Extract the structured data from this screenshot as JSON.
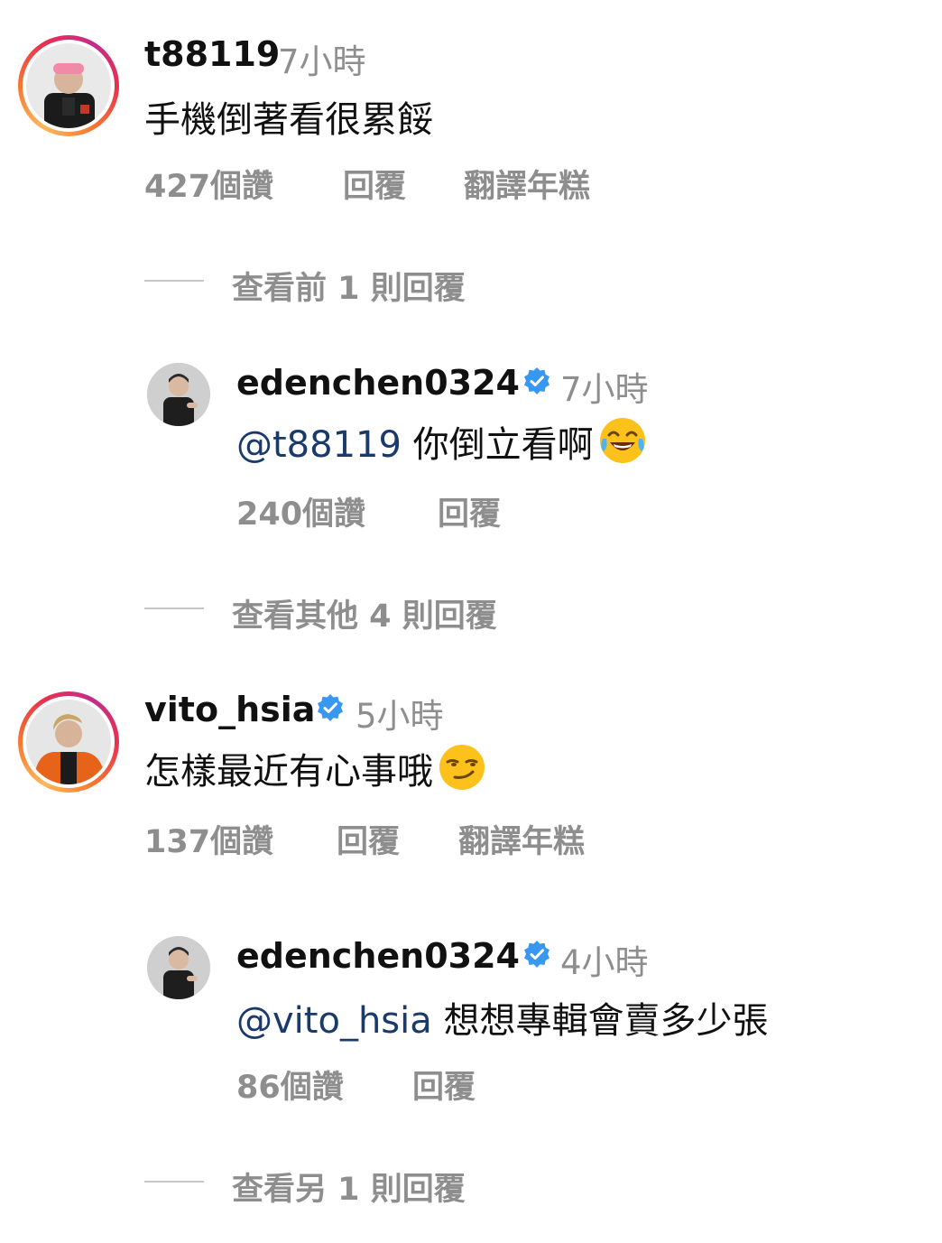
{
  "comments": [
    {
      "username": "t88119",
      "time": "7小時",
      "text": "手機倒著看很累餒",
      "likes": "427個讚",
      "reply_label": "回覆",
      "translate_label": "翻譯年糕",
      "view_replies": "查看前 1 則回覆",
      "replies": [
        {
          "username": "edenchen0324",
          "verified": true,
          "time": "7小時",
          "mention": "@t88119",
          "text": "你倒立看啊",
          "emoji": "face-with-tears-of-joy",
          "likes": "240個讚",
          "reply_label": "回覆"
        }
      ],
      "view_more_replies": "查看其他 4 則回覆"
    },
    {
      "username": "vito_hsia",
      "verified": true,
      "time": "5小時",
      "text": "怎樣最近有心事哦",
      "emoji": "smirking-face",
      "likes": "137個讚",
      "reply_label": "回覆",
      "translate_label": "翻譯年糕",
      "replies": [
        {
          "username": "edenchen0324",
          "verified": true,
          "time": "4小時",
          "mention": "@vito_hsia",
          "text": "想想專輯會賣多少張",
          "likes": "86個讚",
          "reply_label": "回覆"
        }
      ],
      "view_more_replies": "查看另 1 則回覆"
    }
  ],
  "colors": {
    "primary_text": "#111111",
    "secondary_text": "#8e8e8e",
    "mention": "#1a3a6b",
    "verified_badge": "#3897f0"
  }
}
